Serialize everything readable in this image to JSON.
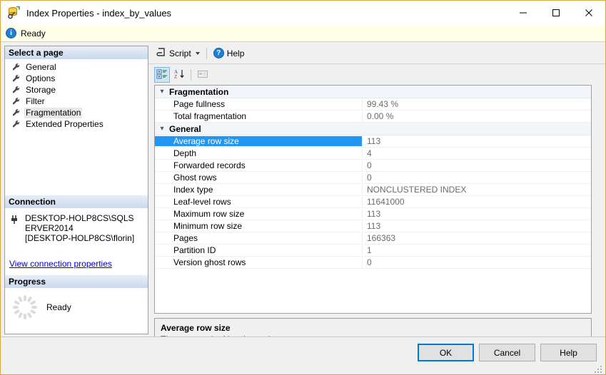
{
  "window": {
    "title": "Index Properties - index_by_values",
    "icon": "index-database-icon",
    "minimize_label": "Minimize",
    "maximize_label": "Maximize",
    "close_label": "Close"
  },
  "statusbar": {
    "icon": "info-icon",
    "text": "Ready"
  },
  "sidebar": {
    "header": "Select a page",
    "items": [
      {
        "label": "General",
        "icon": "wrench-icon",
        "selected": false
      },
      {
        "label": "Options",
        "icon": "wrench-icon",
        "selected": false
      },
      {
        "label": "Storage",
        "icon": "wrench-icon",
        "selected": false
      },
      {
        "label": "Filter",
        "icon": "wrench-icon",
        "selected": false
      },
      {
        "label": "Fragmentation",
        "icon": "wrench-icon",
        "selected": true
      },
      {
        "label": "Extended Properties",
        "icon": "wrench-icon",
        "selected": false
      }
    ],
    "connection": {
      "header": "Connection",
      "icon": "connection-plug-icon",
      "server": "DESKTOP-HOLP8CS\\SQLSERVER2014",
      "user": "[DESKTOP-HOLP8CS\\florin]",
      "link": "View connection properties"
    },
    "progress": {
      "header": "Progress",
      "icon": "spinner-icon",
      "text": "Ready"
    }
  },
  "toolbar": {
    "script_label": "Script",
    "script_icon": "script-icon",
    "script_caret": "dropdown-caret",
    "help_label": "Help",
    "help_icon": "help-icon"
  },
  "grid_toolbar": {
    "categorized_label": "Categorized",
    "categorized_icon": "categorized-view-icon",
    "categorized_active": true,
    "alphabetical_label": "Alphabetical",
    "alphabetical_icon": "sort-az-icon",
    "property_pages_label": "Property Pages",
    "property_pages_icon": "property-pages-icon",
    "property_pages_disabled": true
  },
  "property_grid": {
    "categories": [
      {
        "name": "Fragmentation",
        "expanded": true,
        "rows": [
          {
            "name": "Page fullness",
            "value": "99.43 %",
            "selected": false
          },
          {
            "name": "Total fragmentation",
            "value": "0.00 %",
            "selected": false
          }
        ]
      },
      {
        "name": "General",
        "expanded": true,
        "rows": [
          {
            "name": "Average row size",
            "value": "113",
            "selected": true
          },
          {
            "name": "Depth",
            "value": "4",
            "selected": false
          },
          {
            "name": "Forwarded records",
            "value": "0",
            "selected": false
          },
          {
            "name": "Ghost rows",
            "value": "0",
            "selected": false
          },
          {
            "name": "Index type",
            "value": "NONCLUSTERED INDEX",
            "selected": false
          },
          {
            "name": "Leaf-level rows",
            "value": "11641000",
            "selected": false
          },
          {
            "name": "Maximum row size",
            "value": "113",
            "selected": false
          },
          {
            "name": "Minimum row size",
            "value": "113",
            "selected": false
          },
          {
            "name": "Pages",
            "value": "166363",
            "selected": false
          },
          {
            "name": "Partition ID",
            "value": "1",
            "selected": false
          },
          {
            "name": "Version ghost rows",
            "value": "0",
            "selected": false
          }
        ]
      }
    ]
  },
  "description": {
    "title": "Average row size",
    "text": "The average leaf-level row size."
  },
  "footer": {
    "ok_label": "OK",
    "cancel_label": "Cancel",
    "help_label": "Help"
  },
  "colors": {
    "selection": "#2196f3",
    "accent": "#0078d7",
    "window_border": "#d9a441",
    "status_background": "#ffffe8",
    "link": "#0000cc"
  }
}
